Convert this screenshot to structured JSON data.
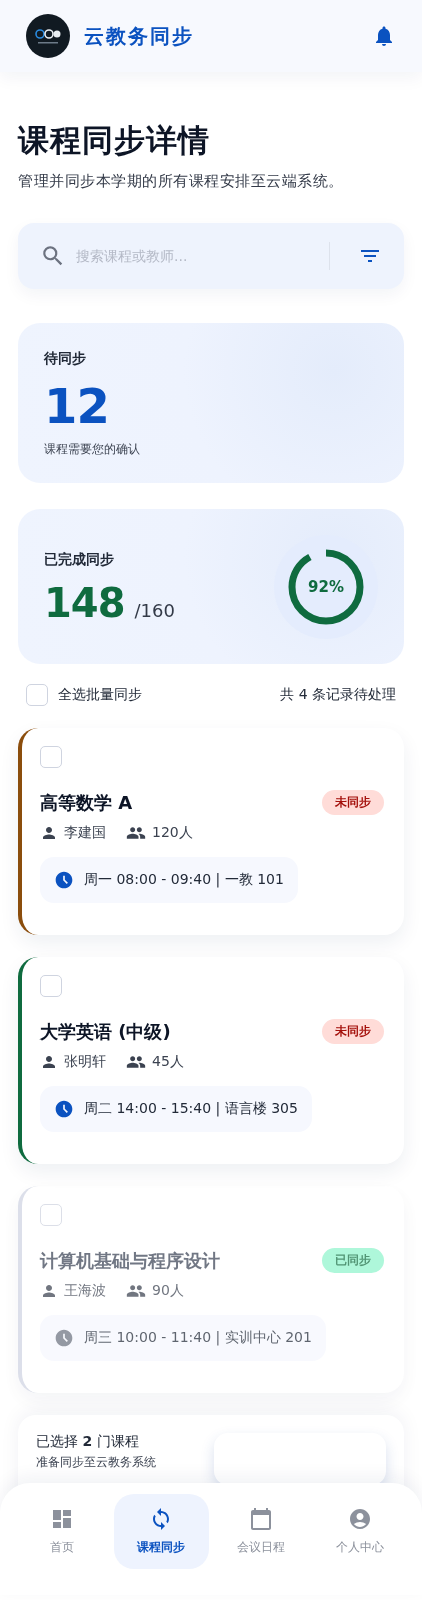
{
  "header": {
    "title": "云教务同步"
  },
  "page": {
    "title": "课程同步详情",
    "subtitle": "管理并同步本学期的所有课程安排至云端系统。"
  },
  "search": {
    "placeholder": "搜索课程或教师..."
  },
  "pending": {
    "label": "待同步",
    "count": "12",
    "note": "课程需要您的确认"
  },
  "completed": {
    "label": "已完成同步",
    "count": "148",
    "total": "/160",
    "percent": "92%",
    "level": 0.92
  },
  "select_all": {
    "label": "全选批量同步",
    "checked": false,
    "summary": "共 4 条记录待处理"
  },
  "courses": [
    {
      "title": "高等数学 A",
      "teacher": "李建国",
      "students": "120人",
      "schedule": "周一 08:00 - 09:40 | 一教 101",
      "status": "未同步",
      "synced": false,
      "color": "#8b4d0c",
      "checked": false
    },
    {
      "title": "大学英语 (中级)",
      "teacher": "张明轩",
      "students": "45人",
      "schedule": "周二 14:00 - 15:40 | 语言楼 305",
      "status": "未同步",
      "synced": false,
      "color": "#0f6b3f",
      "checked": false
    },
    {
      "title": "计算机基础与程序设计",
      "teacher": "王海波",
      "students": "90人",
      "schedule": "周三 10:00 - 11:40 | 实训中心 201",
      "status": "已同步",
      "synced": true,
      "color": "#cfd4e2",
      "checked": false
    }
  ],
  "selection_bar": {
    "text": "已选择 **2** 门课程",
    "note": "准备同步至云教务系统"
  },
  "nav": [
    {
      "label": "首页",
      "kind": "dashboard",
      "selected": false
    },
    {
      "label": "课程同步",
      "kind": "sync",
      "selected": true
    },
    {
      "label": "会议日程",
      "kind": "calendar",
      "selected": false
    },
    {
      "label": "个人中心",
      "kind": "profile",
      "selected": false
    }
  ]
}
